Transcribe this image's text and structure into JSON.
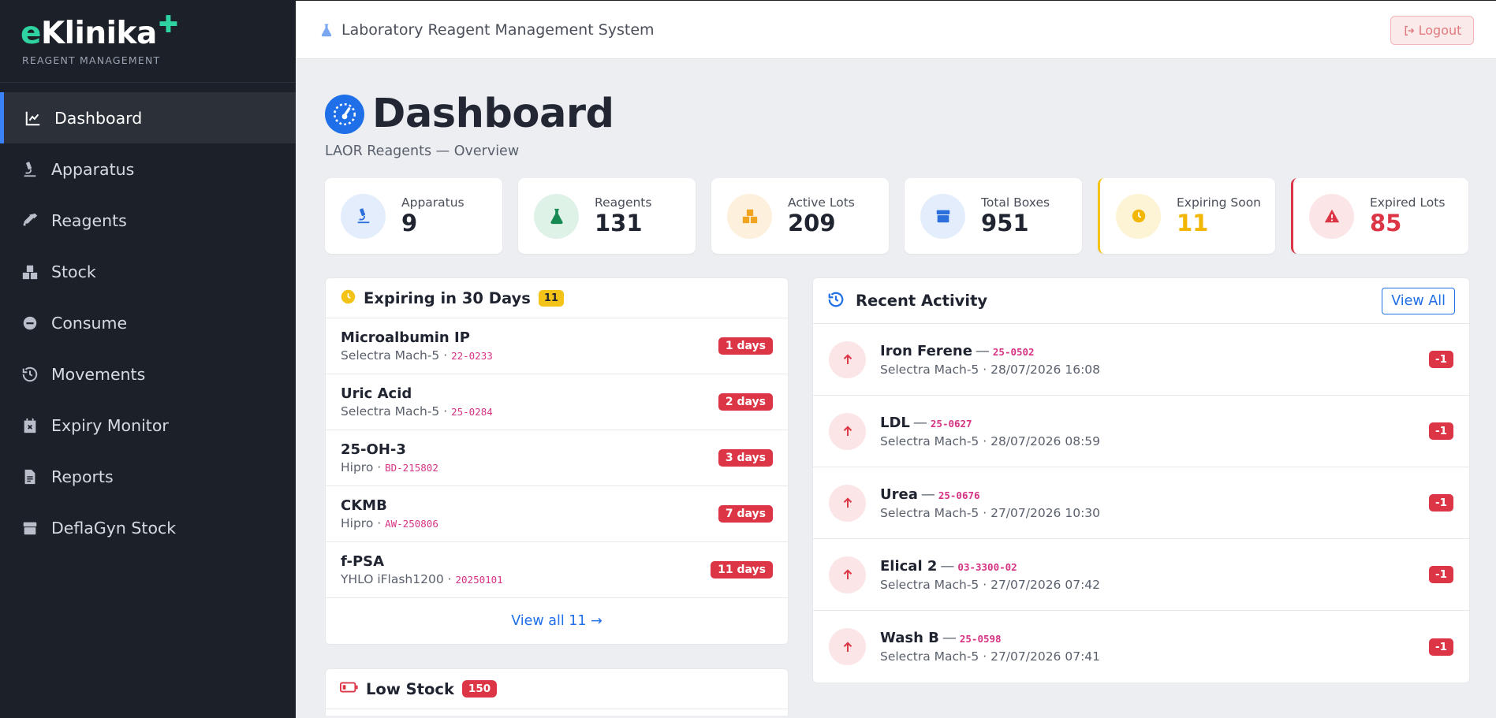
{
  "brand": {
    "logo_e": "e",
    "logo_rest": "Klinika",
    "subtitle": "REAGENT MANAGEMENT"
  },
  "sidebar": {
    "items": [
      {
        "label": "Dashboard",
        "icon": "chart-line-icon",
        "active": true
      },
      {
        "label": "Apparatus",
        "icon": "microscope-icon"
      },
      {
        "label": "Reagents",
        "icon": "pipette-icon"
      },
      {
        "label": "Stock",
        "icon": "boxes-icon"
      },
      {
        "label": "Consume",
        "icon": "minus-circle-icon"
      },
      {
        "label": "Movements",
        "icon": "history-icon"
      },
      {
        "label": "Expiry Monitor",
        "icon": "calendar-x-icon"
      },
      {
        "label": "Reports",
        "icon": "file-icon"
      },
      {
        "label": "DeflaGyn Stock",
        "icon": "box-icon"
      }
    ]
  },
  "topbar": {
    "title": "Laboratory Reagent Management System",
    "logout_label": "Logout"
  },
  "page": {
    "title": "Dashboard",
    "subtitle": "LAOR Reagents — Overview"
  },
  "stats": [
    {
      "label": "Apparatus",
      "value": "9"
    },
    {
      "label": "Reagents",
      "value": "131"
    },
    {
      "label": "Active Lots",
      "value": "209"
    },
    {
      "label": "Total Boxes",
      "value": "951"
    },
    {
      "label": "Expiring Soon",
      "value": "11"
    },
    {
      "label": "Expired Lots",
      "value": "85"
    }
  ],
  "expiring": {
    "title": "Expiring in 30 Days",
    "count": "11",
    "rows": [
      {
        "name": "Microalbumin IP",
        "apparatus": "Selectra Mach-5",
        "lot": "22-0233",
        "days": "1 days"
      },
      {
        "name": "Uric Acid",
        "apparatus": "Selectra Mach-5",
        "lot": "25-0284",
        "days": "2 days"
      },
      {
        "name": "25-OH-3",
        "apparatus": "Hipro",
        "lot": "BD-215802",
        "days": "3 days"
      },
      {
        "name": "CKMB",
        "apparatus": "Hipro",
        "lot": "AW-250806",
        "days": "7 days"
      },
      {
        "name": "f-PSA",
        "apparatus": "YHLO iFlash1200",
        "lot": "20250101",
        "days": "11 days"
      }
    ],
    "view_all": "View all 11 →"
  },
  "low_stock": {
    "title": "Low Stock",
    "count": "150"
  },
  "activity": {
    "title": "Recent Activity",
    "view_all": "View All",
    "rows": [
      {
        "name": "Iron Ferene",
        "lot": "25-0502",
        "apparatus": "Selectra Mach-5",
        "time": "28/07/2026 16:08",
        "qty": "-1"
      },
      {
        "name": "LDL",
        "lot": "25-0627",
        "apparatus": "Selectra Mach-5",
        "time": "28/07/2026 08:59",
        "qty": "-1"
      },
      {
        "name": "Urea",
        "lot": "25-0676",
        "apparatus": "Selectra Mach-5",
        "time": "27/07/2026 10:30",
        "qty": "-1"
      },
      {
        "name": "Elical 2",
        "lot": "03-3300-02",
        "apparatus": "Selectra Mach-5",
        "time": "27/07/2026 07:42",
        "qty": "-1"
      },
      {
        "name": "Wash B",
        "lot": "25-0598",
        "apparatus": "Selectra Mach-5",
        "time": "27/07/2026 07:41",
        "qty": "-1"
      }
    ]
  },
  "colors": {
    "accent": "#1e6fe8",
    "brand": "#2fd3a2",
    "danger": "#dc3545",
    "warning": "#f3c318",
    "sidebar": "#1c2028"
  }
}
